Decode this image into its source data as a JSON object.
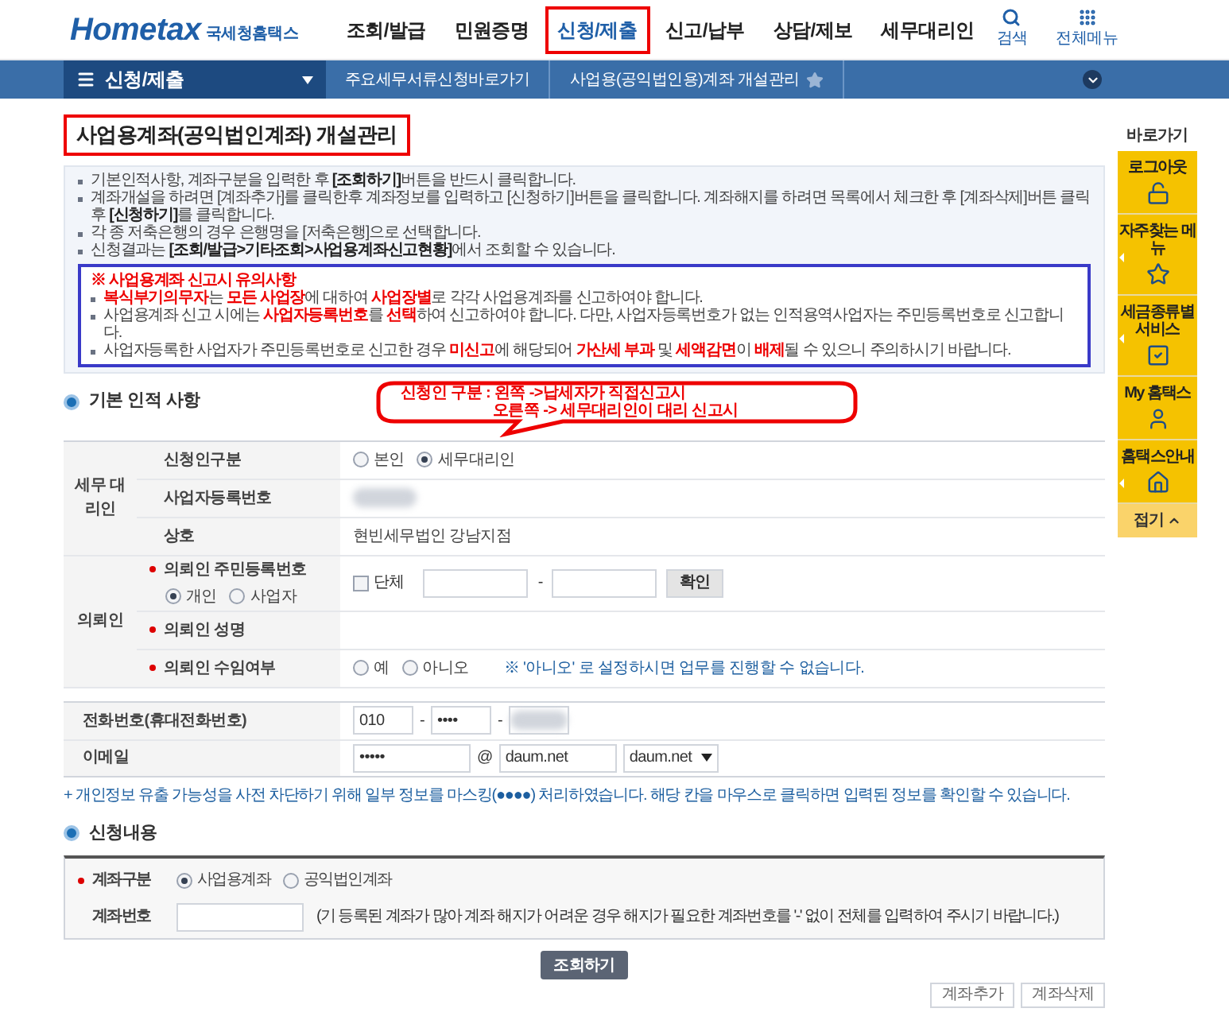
{
  "header": {
    "logo": "Hometax",
    "logo_sub": "국세청홈택스",
    "nav": [
      {
        "label": "조회/발급",
        "selected": false
      },
      {
        "label": "민원증명",
        "selected": false
      },
      {
        "label": "신청/제출",
        "selected": true
      },
      {
        "label": "신고/납부",
        "selected": false
      },
      {
        "label": "상담/제보",
        "selected": false
      },
      {
        "label": "세무대리인",
        "selected": false
      }
    ],
    "tools": [
      {
        "kind": "search",
        "label": "검색"
      },
      {
        "kind": "grid",
        "label": "전체메뉴"
      }
    ]
  },
  "breadcrumb": {
    "menu": "신청/제출",
    "items": [
      "주요세무서류신청바로가기",
      "사업용(공익법인용)계좌 개설관리"
    ]
  },
  "page_title": "사업용계좌(공익법인계좌) 개설관리",
  "guide": [
    "기본인적사항, 계좌구분을 입력한 후 **[조회하기]**버튼을 반드시 클릭합니다.",
    "계좌개설을 하려면 [계좌추가]를 클릭한후 계좌정보를 입력하고 [신청하기]버튼을 클릭합니다. 계좌해지를 하려면 목록에서 체크한 후 [계좌삭제]버튼 클릭 후 **[신청하기]**를 클릭합니다.",
    "각 종 저축은행의 경우 은행명을 [저축은행]으로 선택합니다.",
    "신청결과는 **[조회/발급>기타조회>사업용계좌신고현황]**에서 조회할 수 있습니다."
  ],
  "notice": {
    "title": "※ 사업용계좌 신고시 유의사항",
    "items": [
      "**복식부기의무자**는 **모든 사업장**에 대하여 **사업장별**로 각각 사업용계좌를 신고하여야 합니다.",
      "사업용계좌 신고 시에는 **사업자등록번호**를 **선택**하여 신고하여야 합니다. 다만, 사업자등록번호가 없는 인적용역사업자는 주민등록번호로 신고합니다.",
      "사업자등록한 사업자가 주민등록번호로 신고한 경우 **미신고**에 해당되어 **가산세 부과** 및 **세액감면**이 **배제**될 수 있으니 주의하시기 바랍니다."
    ]
  },
  "callout": {
    "lines": [
      "신청인 구분 : 왼쪽 ->납세자가 직접신고시",
      "오른쪽 -> 세무대리인이 대리 신고시"
    ]
  },
  "basic_info": {
    "title": "기본 인적 사항",
    "groups": [
      {
        "label": "세무 대리인",
        "rows": [
          {
            "label": "신청인구분",
            "required": false,
            "kind": "radio",
            "options": [
              {
                "label": "본인",
                "selected": false
              },
              {
                "label": "세무대리인",
                "selected": true
              }
            ]
          },
          {
            "label": "사업자등록번호",
            "required": false,
            "kind": "masked"
          },
          {
            "label": "상호",
            "required": false,
            "kind": "text",
            "value": "현빈세무법인 강남지점"
          }
        ]
      },
      {
        "label": "의뢰인",
        "rows": [
          {
            "label": "의뢰인 주민등록번호",
            "required": true,
            "kind": "id_number",
            "sub_options": [
              {
                "label": "개인",
                "selected": true
              },
              {
                "label": "사업자",
                "selected": false
              }
            ],
            "checkbox": {
              "label": "단체",
              "checked": false
            },
            "separator": "-",
            "button": "확인"
          },
          {
            "label": "의뢰인 성명",
            "required": true,
            "kind": "empty"
          },
          {
            "label": "의뢰인 수임여부",
            "required": true,
            "kind": "radio",
            "options": [
              {
                "label": "예",
                "selected": false
              },
              {
                "label": "아니오",
                "selected": false
              }
            ],
            "note": "※ '아니오' 로 설정하시면 업무를 진행할 수 없습니다."
          }
        ]
      }
    ]
  },
  "contact": {
    "rows": [
      {
        "label": "전화번호(휴대전화번호)",
        "kind": "phone",
        "fields": [
          "010",
          "••••"
        ],
        "separator": "-"
      },
      {
        "label": "이메일",
        "kind": "email",
        "fields": [
          "•••••",
          "daum.net"
        ],
        "at": "@",
        "select": "daum.net"
      }
    ],
    "note": "+ 개인정보 유출 가능성을 사전 차단하기 위해 일부 정보를 마스킹(●●●●) 처리하였습니다. 해당 칸을 마우스로 클릭하면 입력된 정보를 확인할 수 있습니다."
  },
  "apply": {
    "title": "신청내용",
    "rows": [
      {
        "label": "계좌구분",
        "required": true,
        "kind": "radio",
        "options": [
          {
            "label": "사업용계좌",
            "selected": true
          },
          {
            "label": "공익법인계좌",
            "selected": false
          }
        ]
      },
      {
        "label": "계좌번호",
        "required": false,
        "kind": "input",
        "note": "(기 등록된 계좌가 많아 계좌 해지가 어려운 경우 해지가 필요한 계좌번호를 '-' 없이 전체를 입력하여 주시기 바랍니다.)"
      }
    ]
  },
  "search_button": "조회하기",
  "action_buttons": [
    "계좌추가",
    "계좌삭제"
  ],
  "quick_menu": {
    "title": "바로가기",
    "items": [
      {
        "label": "로그아웃",
        "submenu": false
      },
      {
        "label": "자주찾는 메뉴",
        "submenu": true
      },
      {
        "label": "세금종류별 서비스",
        "submenu": true
      },
      {
        "label": "My 홈택스",
        "submenu": false
      },
      {
        "label": "홈택스안내",
        "submenu": true
      }
    ],
    "fold": "접기"
  }
}
